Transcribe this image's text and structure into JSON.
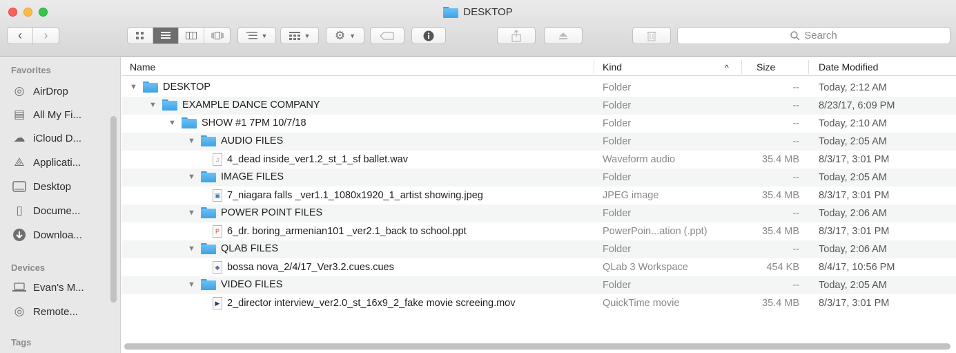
{
  "window": {
    "title": "DESKTOP",
    "search_placeholder": "Search"
  },
  "toolbar": {
    "back_icon": "chevron-left-icon",
    "forward_icon": "chevron-right-icon"
  },
  "sidebar": {
    "favorites_label": "Favorites",
    "favorites": [
      {
        "label": "AirDrop",
        "icon": "airdrop-icon"
      },
      {
        "label": "All My Fi...",
        "icon": "all-my-files-icon"
      },
      {
        "label": "iCloud D...",
        "icon": "cloud-icon"
      },
      {
        "label": "Applicati...",
        "icon": "applications-icon"
      },
      {
        "label": "Desktop",
        "icon": "desktop-icon"
      },
      {
        "label": "Docume...",
        "icon": "documents-icon"
      },
      {
        "label": "Downloa...",
        "icon": "downloads-icon"
      }
    ],
    "devices_label": "Devices",
    "devices": [
      {
        "label": "Evan's M...",
        "icon": "laptop-icon"
      },
      {
        "label": "Remote...",
        "icon": "disc-icon"
      }
    ],
    "tags_label": "Tags"
  },
  "columns": {
    "name": "Name",
    "kind": "Kind",
    "size": "Size",
    "date": "Date Modified",
    "sort_indicator": "^"
  },
  "rows": [
    {
      "name": "DESKTOP",
      "kind": "Folder",
      "size": "--",
      "date": "Today, 2:12 AM",
      "type": "folder",
      "level": 0
    },
    {
      "name": "EXAMPLE DANCE COMPANY",
      "kind": "Folder",
      "size": "--",
      "date": "8/23/17, 6:09 PM",
      "type": "folder",
      "level": 1
    },
    {
      "name": "SHOW #1 7PM 10/7/18",
      "kind": "Folder",
      "size": "--",
      "date": "Today, 2:10 AM",
      "type": "folder",
      "level": 2
    },
    {
      "name": "AUDIO FILES",
      "kind": "Folder",
      "size": "--",
      "date": "Today, 2:05 AM",
      "type": "folder",
      "level": 3
    },
    {
      "name": "4_dead inside_ver1.2_st_1_sf ballet.wav",
      "kind": "Waveform audio",
      "size": "35.4 MB",
      "date": "8/3/17, 3:01 PM",
      "type": "audio",
      "level": 4
    },
    {
      "name": "IMAGE FILES",
      "kind": "Folder",
      "size": "--",
      "date": "Today, 2:05 AM",
      "type": "folder",
      "level": 3
    },
    {
      "name": "7_niagara falls _ver1.1_1080x1920_1_artist showing.jpeg",
      "kind": "JPEG image",
      "size": "35.4 MB",
      "date": "8/3/17, 3:01 PM",
      "type": "image",
      "level": 4
    },
    {
      "name": "POWER POINT FILES",
      "kind": "Folder",
      "size": "--",
      "date": "Today, 2:06 AM",
      "type": "folder",
      "level": 3
    },
    {
      "name": "6_dr. boring_armenian101 _ver2.1_back to school.ppt",
      "kind": "PowerPoin...ation (.ppt)",
      "size": "35.4 MB",
      "date": "8/3/17, 3:01 PM",
      "type": "ppt",
      "level": 4
    },
    {
      "name": "QLAB FILES",
      "kind": "Folder",
      "size": "--",
      "date": "Today, 2:06 AM",
      "type": "folder",
      "level": 3
    },
    {
      "name": "bossa nova_2/4/17_Ver3.2.cues.cues",
      "kind": "QLab 3 Workspace",
      "size": "454 KB",
      "date": "8/4/17, 10:56 PM",
      "type": "qlab",
      "level": 4
    },
    {
      "name": "VIDEO FILES",
      "kind": "Folder",
      "size": "--",
      "date": "Today, 2:05 AM",
      "type": "folder",
      "level": 3
    },
    {
      "name": "2_director interview_ver2.0_st_16x9_2_fake movie screeing.mov",
      "kind": "QuickTime movie",
      "size": "35.4 MB",
      "date": "8/3/17, 3:01 PM",
      "type": "movie",
      "level": 4
    }
  ]
}
